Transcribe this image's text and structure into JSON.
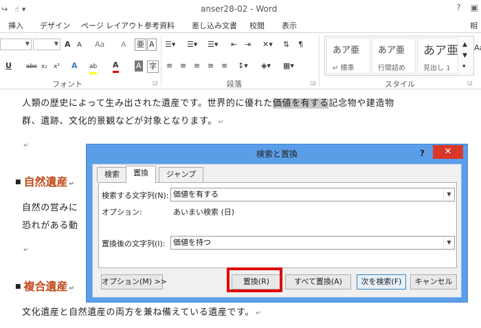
{
  "window": {
    "title": "anser28-02 - Word",
    "help": "?",
    "right_tab": "相"
  },
  "tabs": [
    "挿入",
    "デザイン",
    "ページ レイアウト",
    "参考資料",
    "差し込み文書",
    "校閲",
    "表示"
  ],
  "ribbon": {
    "font_group_label": "フォント",
    "paragraph_group_label": "段落",
    "styles_group_label": "スタイル",
    "font_buttons": {
      "grow": "A",
      "shrink": "A",
      "change_case": "Aa",
      "clear": "A",
      "underline": "U",
      "strike": "abc",
      "subscript": "x₂",
      "superscript": "x²",
      "text_effect": "A",
      "highlight": "ab",
      "font_color": "A",
      "shading": "A"
    },
    "styles": [
      {
        "sample": "あア亜",
        "caption": "↵ 標準"
      },
      {
        "sample": "あア亜",
        "caption": "行間詰め"
      },
      {
        "sample": "あア亜",
        "caption": "見出し 1"
      }
    ],
    "right_sample": "Aa"
  },
  "document": {
    "line1_pre": "人類の歴史によって生み出された遺産です。世界的に優れた",
    "line1_hl": "価値を有する",
    "line1_post": "記念物や建造物",
    "line2": "群、遺跡、文化的景観などが対象となります。",
    "heading1": "自然遺産",
    "line3": "自然の営みに",
    "line4": "恐れがある動",
    "heading2": "複合遺産",
    "line5": "文化遺産と自然遺産の両方を兼ね備えている遺産です。",
    "para_mark": "↵",
    "bullet": "■"
  },
  "dialog": {
    "title": "検索と置換",
    "help": "?",
    "close": "✕",
    "tabs": [
      "検索",
      "置換",
      "ジャンプ"
    ],
    "find_label": "検索する文字列(N):",
    "find_value": "価値を有する",
    "options_label": "オプション:",
    "options_value": "あいまい検索 (日)",
    "replace_label": "置換後の文字列(I):",
    "replace_value": "価値を持つ",
    "buttons": {
      "options": "オプション(M) >>",
      "replace": "置換(R)",
      "replace_all": "すべて置換(A)",
      "find_next": "次を検索(F)",
      "cancel": "キャンセル"
    }
  },
  "colors": {
    "dialog_frame": "#5b9ee8",
    "close_button": "#d9372a",
    "heading": "#c04b1a",
    "callout": "#e00000"
  }
}
